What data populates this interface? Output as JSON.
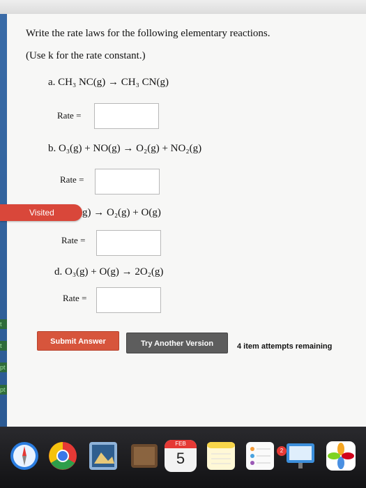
{
  "question": {
    "instruction": "Write the rate laws for the following elementary reactions.",
    "note": "(Use k for the rate constant.)"
  },
  "reactions": {
    "a": "a.  CH₃ NC(g) → CH₃ CN(g)",
    "b": "b.  O₃(g) + NO(g) → O₂(g) + NO₂(g)",
    "c": "g) → O₂(g) + O(g)",
    "d": "d.  O₃(g) + O(g) → 2O₂(g)"
  },
  "rate_label": "Rate =",
  "visited_label": "Visited",
  "buttons": {
    "submit": "Submit Answer",
    "try_another": "Try Another Version"
  },
  "attempts": "4 item attempts remaining",
  "dock": {
    "calendar_month": "FEB",
    "calendar_day": "5",
    "badge_count": "2"
  },
  "side_tabs": [
    "t",
    "t",
    "pt",
    "pt"
  ],
  "colors": {
    "submit_bg": "#d7553c",
    "try_bg": "#5d5d5d",
    "visited_bg": "#d9473a",
    "dock_bg": "#1e1e20"
  }
}
